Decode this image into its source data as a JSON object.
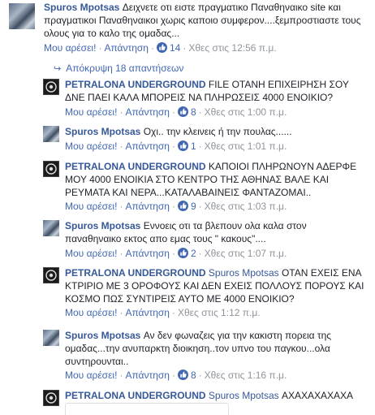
{
  "top_comment": {
    "author": "Spuros Mpotsas",
    "text": "Δειχνετε οτι ειστε πραγματικο Παναθηναικο site και πραγματικοι Παναθηναικοι χωρις καποιο συμφερον....ξεμπροστιαστε τους ολους για το καλο της ομαδας...",
    "like_label": "Μου αρέσει!",
    "reply_label": "Απάντηση",
    "likes": "14",
    "time": "Χθες στις 12:56 π.μ."
  },
  "hide_replies_label": "Απόκρυψη 18 απαντήσεων",
  "replies": [
    {
      "author": "PETRALONA UNDERGROUND",
      "tag": "",
      "text": "FILE ΟΤΑΝΗ ΕΠΙΧΕΙΡΗΣΗ ΣΟΥ ΔΝΕ ΠΑΕΙ ΚΑΛΑ ΜΠΟΡΕΙΣ ΝΑ ΠΛΗΡΩΣΕΙΣ 4000 ΕΝΟΙΚΙΟ?",
      "like_label": "Μου αρέσει!",
      "reply_label": "Απάντηση",
      "likes": "8",
      "time": "Χθες στις 1:00 π.μ."
    },
    {
      "author": "Spuros Mpotsas",
      "tag": "",
      "text": "Οχι.. την κλεινεις ή την πουλας......",
      "like_label": "Μου αρέσει!",
      "reply_label": "Απάντηση",
      "likes": "1",
      "time": "Χθες στις 1:01 π.μ."
    },
    {
      "author": "PETRALONA UNDERGROUND",
      "tag": "",
      "text": "ΚΑΠΟΙΟΙ ΠΛΗΡΩΝΟΥΝ ΑΔΕΡΦΕ ΜΟΥ 4000 ΕΝΟΙΚΙΑ ΣΤΟ ΚΕΝΤΡΟ ΤΗΣ ΑΘΗΝΑΣ ΒΑΛΕ ΚΑΙ ΡΕΥΜΑΤΑ ΚΑΙ ΝΕΡΑ...ΚΑΤΑΛΑΒΑΙΝΕΙΣ ΦΑΝΤΑΖΟΜΑΙ..",
      "like_label": "Μου αρέσει!",
      "reply_label": "Απάντηση",
      "likes": "9",
      "time": "Χθες στις 1:03 π.μ."
    },
    {
      "author": "Spuros Mpotsas",
      "tag": "",
      "text": "Εννοεις οτι τα βλεπουν ολα καλα στον παναθηναικο εκτος απο εμας τους \" κακους\"....",
      "like_label": "Μου αρέσει!",
      "reply_label": "Απάντηση",
      "likes": "2",
      "time": "Χθες στις 1:07 π.μ."
    },
    {
      "author": "PETRALONA UNDERGROUND",
      "tag": "Spuros Mpotsas",
      "text": "ΟΤΑΝ ΕΧΕΙΣ ΕΝΑ ΚΤΡΙΡΙΟ ΜΕ 3 ΟΡΟΦΟΥΣ ΚΑΙ ΔΕΝ ΕΧΕΙΣ ΠΟΛΛΟΥΣ ΠΟΡΟΥΣ ΚΑΙ ΚΟΣΜΟ ΠΩΣ ΣΥΝΤΙΡΕΙΣ ΑΥΤΟ ΜΕ 4000 ΕΝΟΙΚΙΟ?",
      "like_label": "Μου αρέσει!",
      "reply_label": "Απάντηση",
      "likes": "",
      "time": "Χθες στις 1:12 π.μ."
    },
    {
      "author": "Spuros Mpotsas",
      "tag": "",
      "text": "Αν δεν φωναζεις για την κακιστη πορεια της ομαδας...την ανυπαρκτη διοικηση..τον υπνο του παγκου...ολα συντηρουνται..",
      "like_label": "Μου αρέσει!",
      "reply_label": "Απάντηση",
      "likes": "8",
      "time": "Χθες στις 1:16 π.μ."
    },
    {
      "author": "PETRALONA UNDERGROUND",
      "tag": "Spuros Mpotsas",
      "text": "ΑΧΑΧΑΧΑΧΑΧΑ",
      "like_label": "",
      "reply_label": "",
      "likes": "",
      "time": ""
    }
  ],
  "colors": {
    "link": "#365899",
    "meta": "#90949c",
    "action": "#4267b2",
    "text": "#1d2129"
  }
}
